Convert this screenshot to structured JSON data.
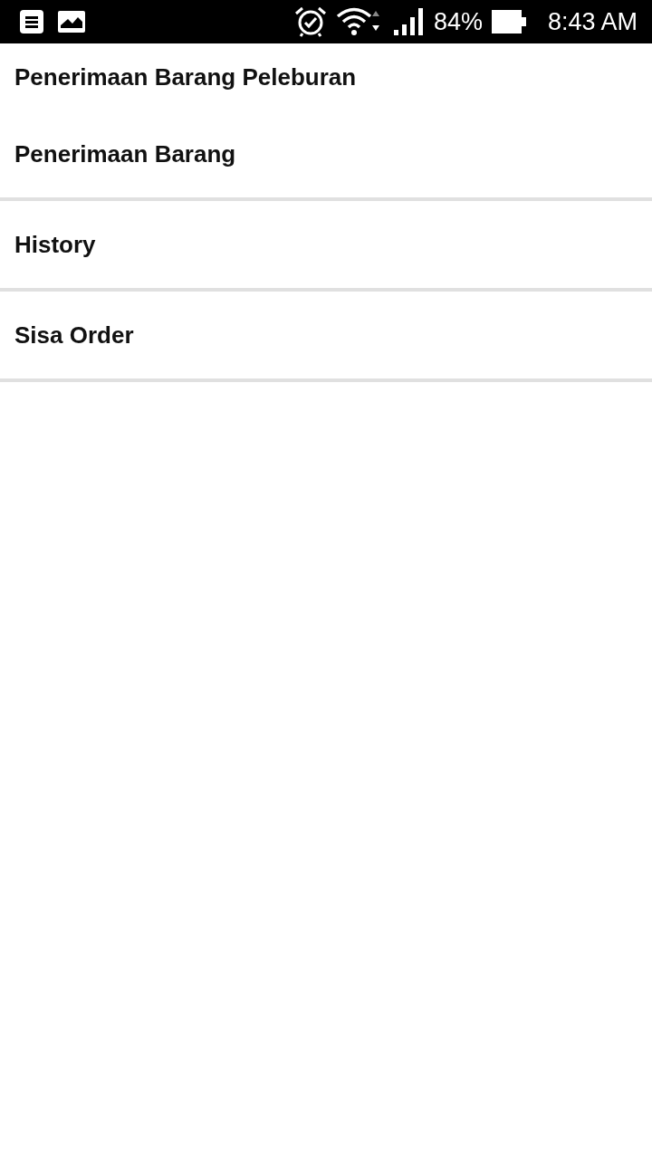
{
  "status_bar": {
    "battery": "84%",
    "time": "8:43 AM"
  },
  "title": "Penerimaan Barang Peleburan",
  "menu": [
    {
      "label": "Penerimaan Barang"
    },
    {
      "label": "History"
    },
    {
      "label": "Sisa Order"
    }
  ]
}
